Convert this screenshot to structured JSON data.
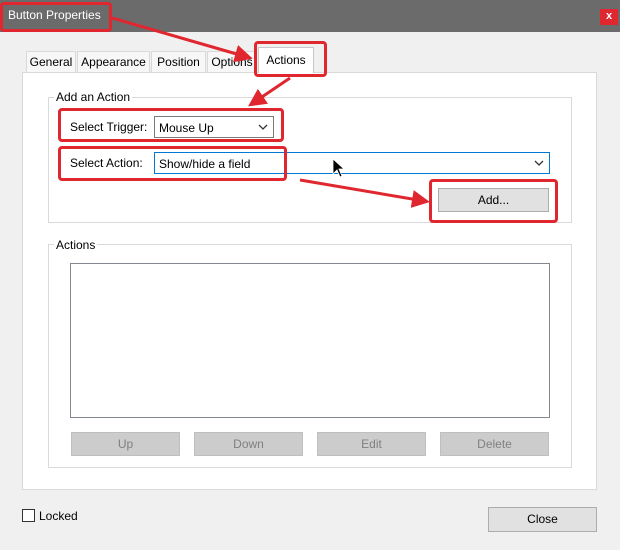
{
  "window": {
    "title": "Button Properties",
    "close_glyph": "x"
  },
  "tabs": [
    {
      "label": "General"
    },
    {
      "label": "Appearance"
    },
    {
      "label": "Position"
    },
    {
      "label": "Options"
    },
    {
      "label": "Actions",
      "active": true
    }
  ],
  "add_action": {
    "legend": "Add an Action",
    "trigger_label": "Select Trigger:",
    "trigger_value": "Mouse Up",
    "action_label": "Select Action:",
    "action_value": "Show/hide a field",
    "add_button": "Add..."
  },
  "actions_group": {
    "legend": "Actions",
    "items": [],
    "buttons": {
      "up": "Up",
      "down": "Down",
      "edit": "Edit",
      "delete": "Delete"
    }
  },
  "footer": {
    "locked_label": "Locked",
    "locked_checked": false,
    "close_button": "Close"
  },
  "annotation_color": "#e0262f",
  "icons": [
    "chevron-down-icon",
    "mouse-pointer-icon",
    "arrow-icon"
  ]
}
